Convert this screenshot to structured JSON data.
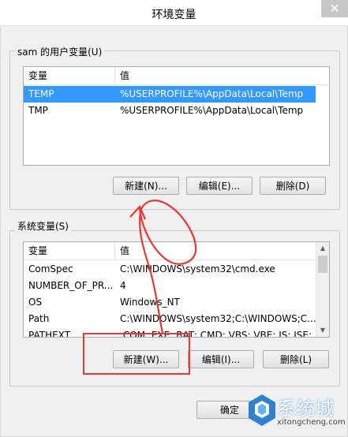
{
  "window": {
    "title": "环境变量",
    "close_glyph": "✕"
  },
  "user_vars": {
    "group_label": "sam 的用户变量(U)",
    "columns": [
      "变量",
      "值"
    ],
    "rows": [
      {
        "name": "TEMP",
        "value": "%USERPROFILE%\\AppData\\Local\\Temp",
        "selected": true
      },
      {
        "name": "TMP",
        "value": "%USERPROFILE%\\AppData\\Local\\Temp",
        "selected": false
      }
    ],
    "buttons": {
      "new": "新建(N)...",
      "edit": "编辑(E)...",
      "delete": "删除(D)"
    }
  },
  "system_vars": {
    "group_label": "系统变量(S)",
    "columns": [
      "变量",
      "值"
    ],
    "rows": [
      {
        "name": "ComSpec",
        "value": "C:\\WINDOWS\\system32\\cmd.exe"
      },
      {
        "name": "NUMBER_OF_PR...",
        "value": "4"
      },
      {
        "name": "OS",
        "value": "Windows_NT"
      },
      {
        "name": "Path",
        "value": "C:\\WINDOWS\\system32;C:\\WINDOWS;C..."
      },
      {
        "name": "PATHEXT",
        "value": ".COM;.EXE;.BAT;.CMD;.VBS;.VBE;.JS;.JSE;..."
      }
    ],
    "buttons": {
      "new": "新建(W)...",
      "edit": "编辑(I)...",
      "delete": "删除(L)"
    }
  },
  "footer": {
    "ok": "确定"
  },
  "watermark": {
    "brand": "系统城",
    "url": "xitongcheng.com"
  },
  "colors": {
    "selection": "#3399ff",
    "annotation": "#e53935",
    "watermark_blue": "#2f80d1"
  }
}
